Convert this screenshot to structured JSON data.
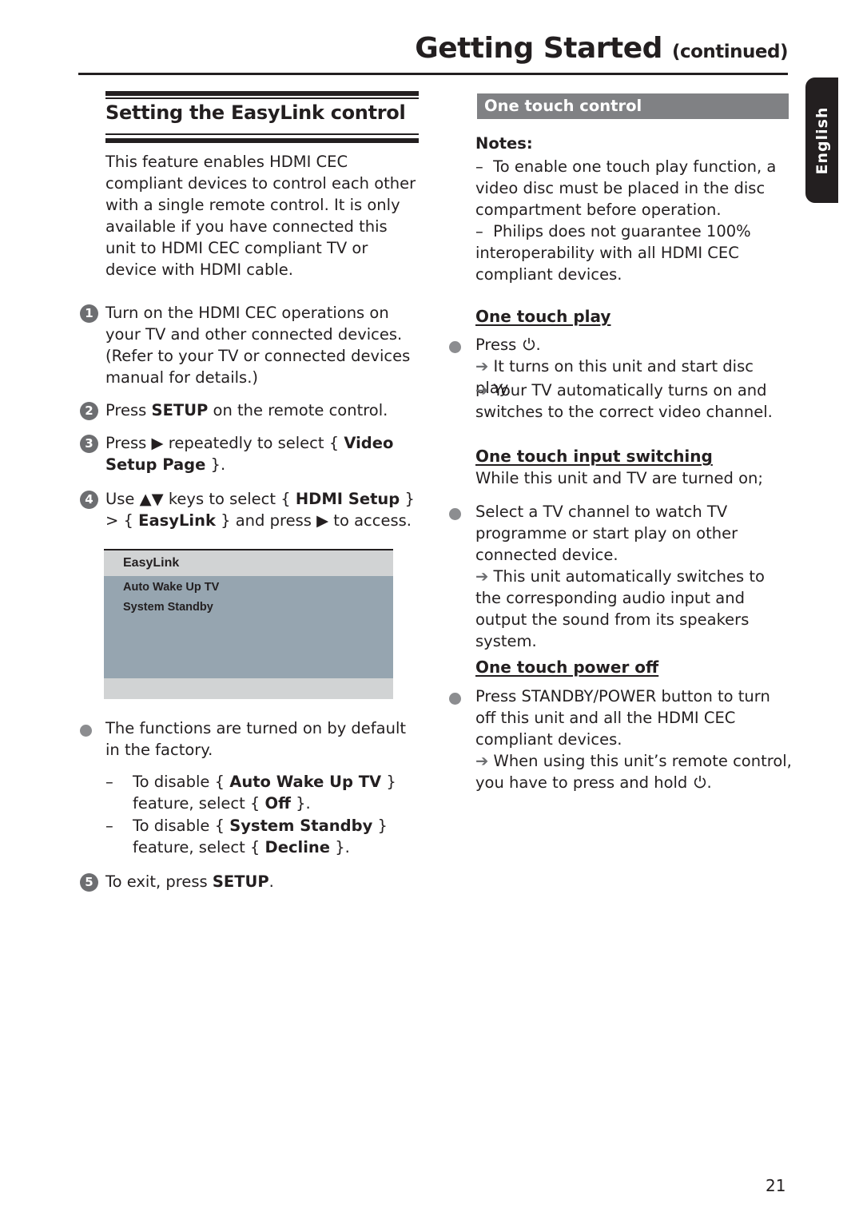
{
  "header": {
    "title": "Getting Started",
    "title_suffix": "(continued)",
    "language_tab": "English"
  },
  "left": {
    "section_title": "Setting the EasyLink control",
    "intro": "This feature enables HDMI CEC compliant devices to control each other with a single remote control. It is only available if you have connected this unit to HDMI CEC compliant TV or device with HDMI cable.",
    "steps": [
      {
        "num": "1",
        "text": "Turn on the HDMI CEC operations on your TV and other connected devices. (Refer to your TV or connected devices manual for details.)"
      },
      {
        "num": "2",
        "pre": "Press ",
        "bold": "SETUP",
        "post": " on the remote control."
      },
      {
        "num": "3",
        "pre": "Press ",
        "key": "▶",
        "mid": " repeatedly to select { ",
        "bold": "Video Setup Page",
        "post": " }."
      },
      {
        "num": "4",
        "pre": "Use ",
        "key": "▲▼",
        "mid": " keys to select { ",
        "bold": "HDMI Setup",
        "mid2": " } > { ",
        "bold2": "EasyLink",
        "mid3": " } and press ",
        "key2": "▶",
        "post": " to access."
      },
      {
        "num": "5",
        "pre": "To exit, press ",
        "bold": "SETUP",
        "post": "."
      }
    ],
    "menu": {
      "header": "EasyLink",
      "items": [
        "Auto Wake Up TV",
        "System Standby"
      ]
    },
    "bullet": "The functions are turned on by default in the factory.",
    "dashes": [
      {
        "pre": "To disable { ",
        "bold": "Auto Wake Up TV",
        "mid": " } feature, select { ",
        "bold2": "Off",
        "post": " }."
      },
      {
        "pre": "To disable { ",
        "bold": "System Standby",
        "mid": " } feature, select { ",
        "bold2": "Decline",
        "post": " }."
      }
    ]
  },
  "right": {
    "section_title": "One touch control",
    "notes_heading": "Notes:",
    "notes": [
      "To enable one touch play function, a video disc must be placed in the disc compartment before operation.",
      "Philips does not guarantee 100% interoperability with all HDMI CEC compliant devices."
    ],
    "play": {
      "heading": "One touch play",
      "bullet_pre": "Press ",
      "bullet_post": ".",
      "results": [
        "It turns on this unit and start disc play.",
        "Your TV automatically turns on and switches to the correct video channel."
      ]
    },
    "input": {
      "heading": "One touch input switching",
      "lead": "While this unit and TV are turned on;",
      "bullet": "Select a TV channel to watch TV programme or start play on other connected device.",
      "result": "This unit automatically switches to the corresponding audio input and output the sound from its speakers system."
    },
    "power": {
      "heading": "One touch power off",
      "bullet": "Press STANDBY/POWER button to turn off this unit and all the HDMI CEC compliant devices.",
      "result_pre": "When using this unit’s remote control, you have to press and hold ",
      "result_post": "."
    },
    "arrow_glyph": "➔",
    "dash_glyph": "–"
  },
  "footer": {
    "page_number": "21"
  }
}
